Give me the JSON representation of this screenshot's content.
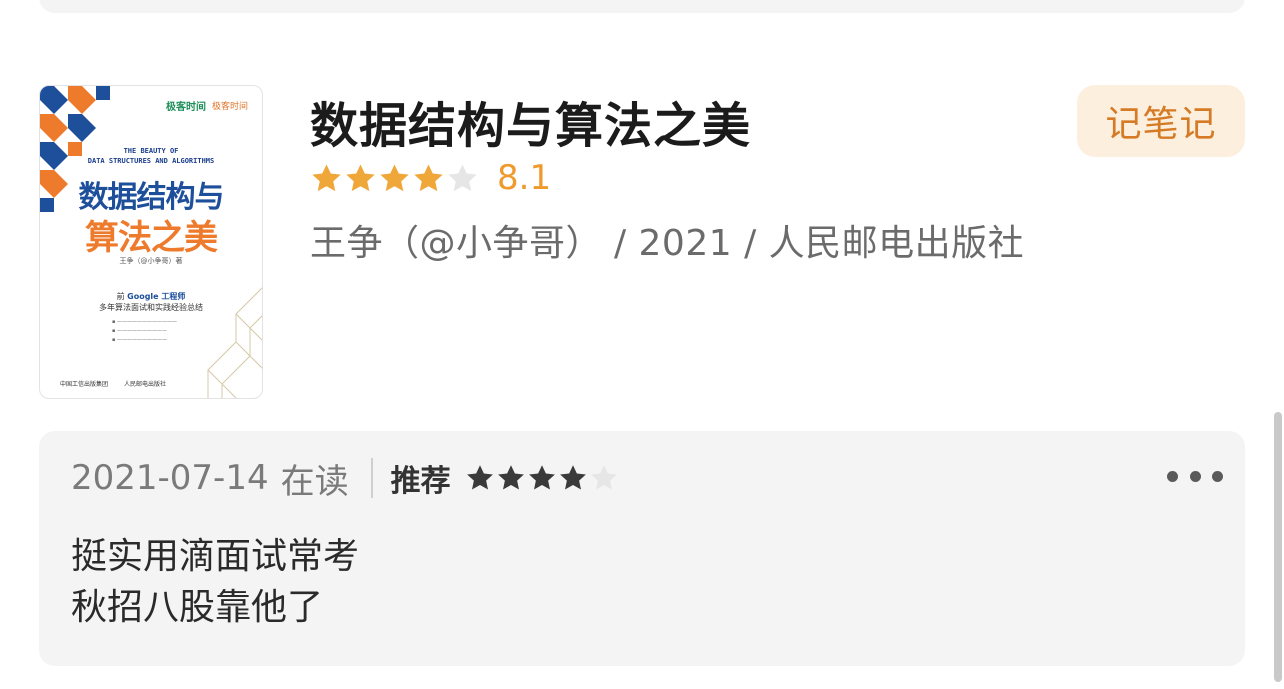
{
  "book": {
    "title": "数据结构与算法之美",
    "rating_stars": 4,
    "rating_max": 5,
    "score": "8.1",
    "meta": "王争（@小争哥） / 2021 / 人民邮电出版社",
    "cover": {
      "logo_a": "极客时间",
      "logo_b": "极客时间",
      "english_title": "THE BEAUTY OF\nDATA STRUCTURES AND ALGORITHMS",
      "title_line1": "数据结构与",
      "title_line2": "算法之美",
      "author": "王争（@小争哥）著",
      "rec_line1_pre": "前",
      "rec_line1_hl": "Google 工程师",
      "rec_line2": "多年算法面试和实践经验总结",
      "publisher_a": "中国工信出版集团",
      "publisher_b": "人民邮电出版社"
    }
  },
  "actions": {
    "note_label": "记笔记"
  },
  "review": {
    "date": "2021-07-14",
    "status": "在读",
    "recommend_label": "推荐",
    "stars": 4,
    "stars_max": 5,
    "lines": [
      "挺实用滴面试常考",
      "秋招八股靠他了"
    ]
  },
  "colors": {
    "star_filled_book": "#f0a73a",
    "star_empty": "#e6e6e6",
    "star_filled_review": "#3a3a3a",
    "score": "#ef9a2c",
    "note_bg": "#fcefde",
    "note_text": "#d57a25",
    "card_bg": "#f4f4f4"
  }
}
